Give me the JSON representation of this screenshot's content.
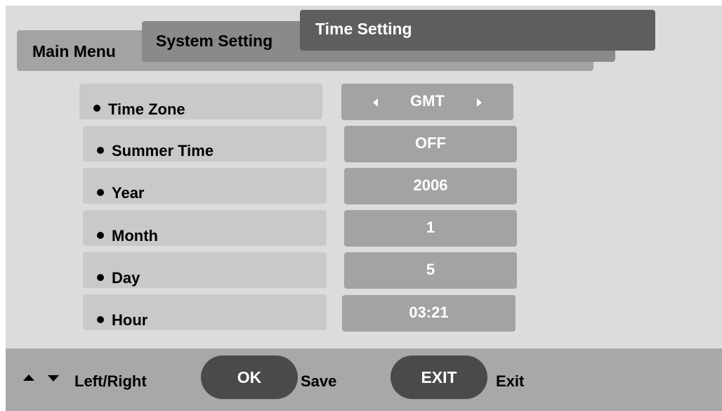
{
  "tabs": {
    "main": "Main Menu",
    "system": "System Setting",
    "time": "Time Setting"
  },
  "rows": [
    {
      "label": "Time Zone",
      "value": "GMT",
      "has_arrows": true
    },
    {
      "label": "Summer Time",
      "value": "OFF"
    },
    {
      "label": "Year",
      "value": "2006"
    },
    {
      "label": "Month",
      "value": "1"
    },
    {
      "label": "Day",
      "value": "5"
    },
    {
      "label": "Hour",
      "value": "03:21"
    }
  ],
  "footer": {
    "nav_label": "Left/Right",
    "ok_button": "OK",
    "ok_action": "Save",
    "exit_button": "EXIT",
    "exit_action": "Exit"
  },
  "colors": {
    "background": "#dcdcdc",
    "active_tab": "#5e5e5e",
    "value_box": "#a3a3a3",
    "button": "#4a4a4a"
  }
}
